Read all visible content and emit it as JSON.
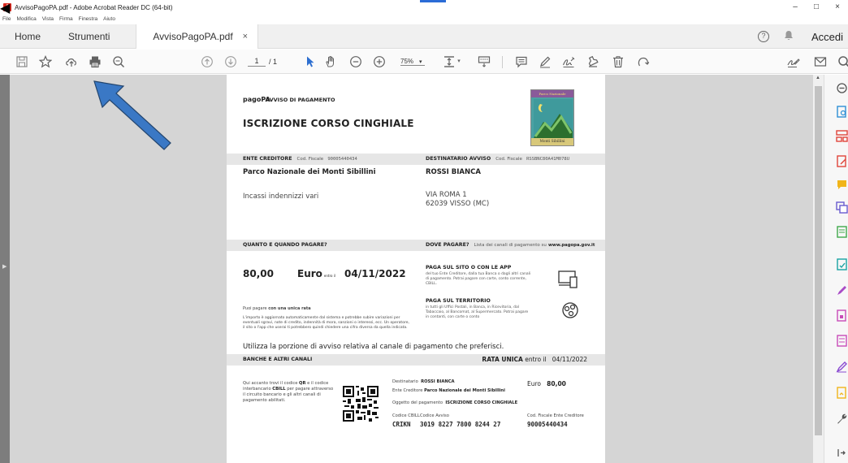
{
  "window": {
    "title": "AvvisoPagoPA.pdf - Adobe Acrobat Reader DC (64-bit)",
    "controls": [
      "–",
      "□",
      "×"
    ]
  },
  "menubar": {
    "items": [
      "File",
      "Modifica",
      "Vista",
      "Firma",
      "Finestra",
      "Aiuto"
    ]
  },
  "tabs": {
    "home": "Home",
    "tools": "Strumenti",
    "document": "AvvisoPagoPA.pdf",
    "close": "×",
    "signin": "Accedi",
    "help": "?"
  },
  "toolbar": {
    "current_page": "1",
    "total_pages": "/ 1",
    "zoom": "75%",
    "zoom_caret": "▾"
  },
  "document": {
    "brand": "pagoPA",
    "notice_label": "AVVISO DI PAGAMENTO",
    "title": "ISCRIZIONE CORSO CINGHIALE",
    "park_logo_top": "Parco Nazionale",
    "park_logo_bottom": "Monti Sibillini",
    "creditor_label": "ENTE CREDITORE",
    "creditor_cf_label": "Cod. Fiscale",
    "creditor_cf": "90005440434",
    "recipient_label": "DESTINATARIO AVVISO",
    "recipient_cf_label": "Cod. Fiscale",
    "recipient_cf": "RSSBNC80A41M078U",
    "creditor_name": "Parco Nazionale dei Monti Sibillini",
    "recipient_name": "ROSSI BIANCA",
    "description": "Incassi indennizzi vari",
    "address_line1": "VIA ROMA 1",
    "address_line2": "62039 VISSO (MC)",
    "when_label": "QUANTO E QUANDO PAGARE?",
    "where_label": "DOVE PAGARE?",
    "where_note": "Lista dei canali di pagamento su",
    "where_site": "www.pagopa.gov.it",
    "amount": "80,00",
    "currency": "Euro",
    "entro": "entro il",
    "due_date": "04/11/2022",
    "single_pay_prefix": "Puoi pagare",
    "single_pay_bold": "con una unica rata",
    "update_note": "L'importo è aggiornato automaticamente dal sistema e potrebbe subire variazioni per eventuali sgravi, note di credito, indennità di mora, sanzioni o interessi, ecc. Un operatore, il sito o l'app che userai ti potrebbero quindi chiedere una cifra diversa da quella indicata.",
    "app_title": "PAGA SUL SITO O CON LE APP",
    "app_text": "del tuo Ente Creditore, dalla tua Banca o dagli altri canali di pagamento. Potrai pagare con carte, conto corrente, CBILL.",
    "territory_title": "PAGA SUL TERRITORIO",
    "territory_text": "in tutti gli Uffici Postali, in Banca, in Ricevitoria, dal Tabaccaio, al Bancomat, al Supermercato. Potrai pagare in contanti, con carte o conto",
    "utilizza": "Utilizza la porzione di avviso relativa al canale di pagamento che preferisci.",
    "banks_label": "BANCHE E ALTRI CANALI",
    "rata_unica": "RATA UNICA",
    "rata_entro": "entro il",
    "rata_date": "04/11/2022",
    "qr_text_1": "Qui accanto trovi il codice ",
    "qr_text_qr": "QR",
    "qr_text_2": " e il codice interbancario ",
    "qr_text_cbill": "CBILL",
    "qr_text_3": " per pagare attraverso il circuito bancario e gli altri canali di pagamento abilitati.",
    "dest_label": "Destinatario",
    "dest_value": "ROSSI BIANCA",
    "ente_label": "Ente Creditore",
    "ente_value": "Parco Nazionale dei Monti Sibillini",
    "oggetto_label": "Oggetto del pagamento",
    "oggetto_value": "ISCRIZIONE CORSO CINGHIALE",
    "euro_label": "Euro",
    "euro_value": "80,00",
    "cbill_label": "Codice CBILL",
    "cbill_value": "CRIKN",
    "avviso_label": "Codice Avviso",
    "avviso_value": "3019 8227 7800 8244 27",
    "cf_ente_label": "Cod. Fiscale Ente Creditore",
    "cf_ente_value": "90005440434"
  },
  "colors": {
    "workspace": "#5e5e5e",
    "side_panels": "#d5d5d5",
    "annotation_arrow": "#3a78c5",
    "acrobat_red": "#d8281e"
  },
  "icons": {
    "toolbar": [
      "save-icon",
      "star-icon",
      "upload-icon",
      "print-icon",
      "zoom-search-icon",
      "page-up-icon",
      "page-down-icon",
      "select-cursor-icon",
      "hand-icon",
      "zoom-out-icon",
      "zoom-in-icon",
      "fit-page-icon",
      "keyboard-icon",
      "comment-icon",
      "pen-icon",
      "sign-icon",
      "stamp-icon",
      "trash-icon",
      "rotate-icon",
      "sign-share-icon",
      "mail-icon",
      "search-icon"
    ],
    "right_panel": [
      "export-pdf-icon",
      "create-pdf-icon",
      "organize-icon",
      "edit-pdf-icon",
      "comment-tool-icon",
      "combine-icon",
      "compress-icon",
      "scan-icon",
      "fill-sign-icon",
      "protect-icon",
      "form-icon",
      "pen-tool-icon",
      "file-icon",
      "wrench-icon"
    ]
  }
}
